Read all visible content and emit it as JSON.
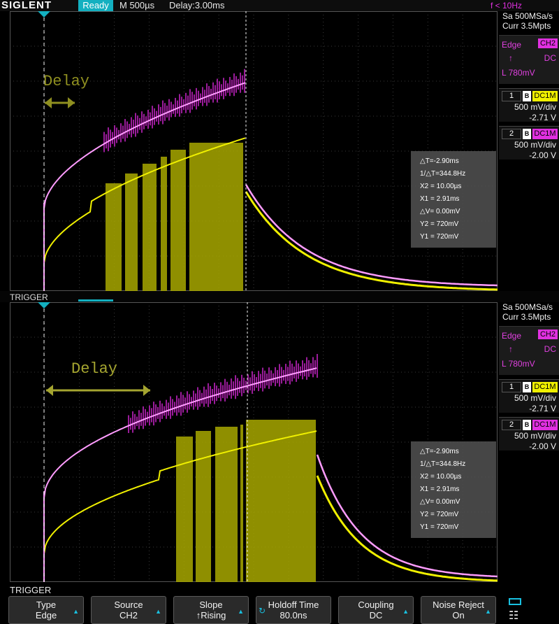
{
  "topbar": {
    "logo": "SIGLENT",
    "status": "Ready",
    "timebase": "M 500µs",
    "delay": "Delay:3.00ms",
    "trigger_freq": "f < 10Hz"
  },
  "panels": [
    {
      "annotation": "Delay",
      "acquire": {
        "sample_rate": "Sa 500MSa/s",
        "memory": "Curr 3.5Mpts"
      },
      "trigger": {
        "type": "Edge",
        "source": "CH2",
        "coupling": "DC",
        "level": "L  780mV"
      },
      "channels": [
        {
          "num": "1",
          "bw": "B",
          "coupling": "DC1M",
          "vdiv": "500 mV/div",
          "offset": "-2.71 V",
          "color": "#f0f000"
        },
        {
          "num": "2",
          "bw": "B",
          "coupling": "DC1M",
          "vdiv": "500 mV/div",
          "offset": "-2.00 V",
          "color": "#e030e0"
        }
      ],
      "measure": [
        "△T=-2.90ms",
        "1/△T=344.8Hz",
        "X2 = 10.00µs",
        "X1 = 2.91ms",
        "△V= 0.00mV",
        "Y2 = 720mV",
        "Y1 = 720mV"
      ]
    },
    {
      "annotation": "Delay",
      "acquire": {
        "sample_rate": "Sa 500MSa/s",
        "memory": "Curr 3.5Mpts"
      },
      "trigger": {
        "type": "Edge",
        "source": "CH2",
        "coupling": "DC",
        "level": "L  780mV"
      },
      "channels": [
        {
          "num": "1",
          "bw": "B",
          "coupling": "DC1M",
          "vdiv": "500 mV/div",
          "offset": "-2.71 V",
          "color": "#f0f000"
        },
        {
          "num": "2",
          "bw": "B",
          "coupling": "DC1M",
          "vdiv": "500 mV/div",
          "offset": "-2.00 V",
          "color": "#e030e0"
        }
      ],
      "measure": [
        "△T=-2.90ms",
        "1/△T=344.8Hz",
        "X2 = 10.00µs",
        "X1 = 2.91ms",
        "△V= 0.00mV",
        "Y2 = 720mV",
        "Y1 = 720mV"
      ]
    }
  ],
  "separator_label": "TRIGGER",
  "menu_title": "TRIGGER",
  "menu": [
    {
      "title": "Type",
      "value": "Edge"
    },
    {
      "title": "Source",
      "value": "CH2"
    },
    {
      "title": "Slope",
      "value": "↑Rising"
    },
    {
      "title": "Holdoff Time",
      "value": "80.0ns"
    },
    {
      "title": "Coupling",
      "value": "DC"
    },
    {
      "title": "Noise Reject",
      "value": "On"
    }
  ],
  "icons": {
    "battery": "battery-icon",
    "network": "network-icon",
    "slope": "rising-edge-icon",
    "knob": "adjust-knob-icon",
    "trigger_marker": "trigger-position-marker-icon",
    "level_marker": "trigger-level-marker-icon",
    "menu_arrow": "menu-arrow-icon"
  },
  "colors": {
    "ch1": "#f0f000",
    "ch2": "#e030e0",
    "accent": "#13b0c0",
    "cursor": "#f0f0f0",
    "annotation": "#9a9a30"
  }
}
